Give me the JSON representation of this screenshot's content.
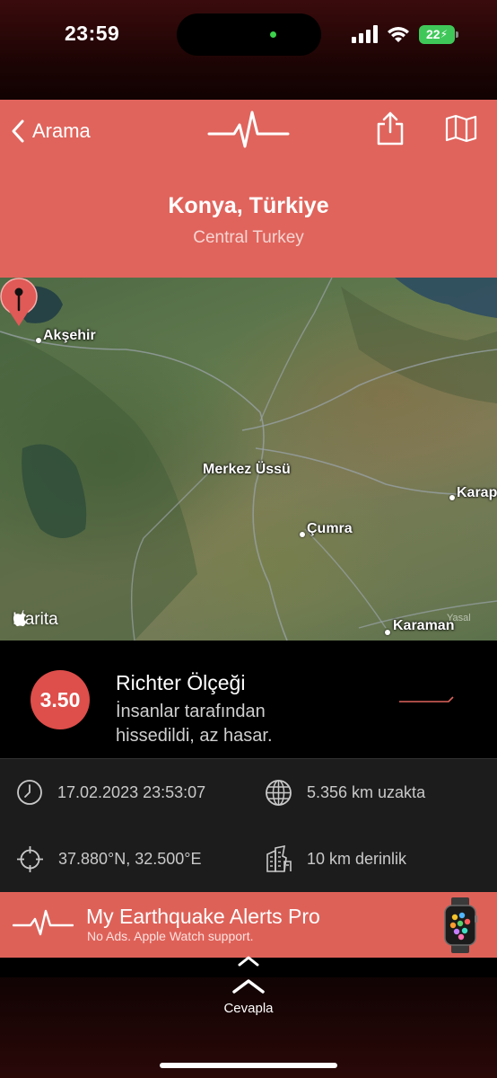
{
  "status_bar": {
    "time": "23:59",
    "battery": "22"
  },
  "header": {
    "back_label": "Arama",
    "place_title": "Konya, Türkiye",
    "place_subtitle": "Central Turkey",
    "accent_color": "#e0645c"
  },
  "map": {
    "cities": [
      {
        "name": "Akşehir"
      },
      {
        "name": "Çumra"
      },
      {
        "name": "Karaman"
      },
      {
        "name": "Karapı"
      }
    ],
    "epicenter_label": "Merkez Üssü",
    "attribution": "Harita",
    "legal": "Yasal"
  },
  "magnitude": {
    "value": "3.50",
    "scale_label": "Richter Ölçeği",
    "description": "İnsanlar tarafından hissedildi, az hasar."
  },
  "details": {
    "datetime": "17.02.2023 23:53:07",
    "distance": "5.356 km uzakta",
    "coordinates": "37.880°N, 32.500°E",
    "depth": "10 km derinlik"
  },
  "banner": {
    "title": "My Earthquake Alerts Pro",
    "subtitle": "No Ads. Apple Watch support."
  },
  "reply": {
    "label": "Cevapla"
  }
}
